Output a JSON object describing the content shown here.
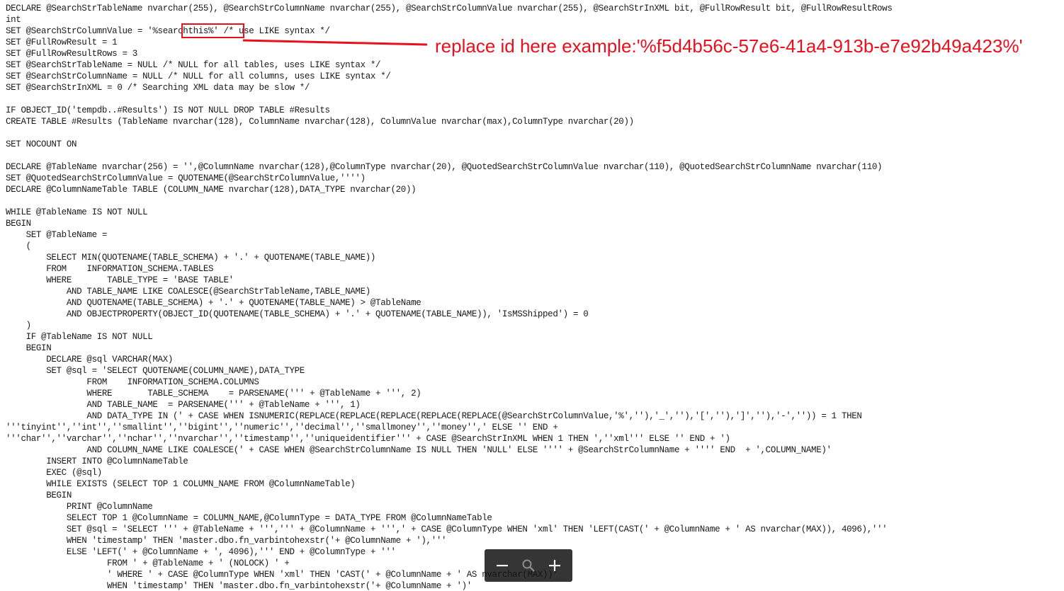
{
  "code": {
    "lines": [
      "DECLARE @SearchStrTableName nvarchar(255), @SearchStrColumnName nvarchar(255), @SearchStrColumnValue nvarchar(255), @SearchStrInXML bit, @FullRowResult bit, @FullRowResultRows",
      "int",
      "SET @SearchStrColumnValue = '%searchthis%' /* use LIKE syntax */",
      "SET @FullRowResult = 1",
      "SET @FullRowResultRows = 3",
      "SET @SearchStrTableName = NULL /* NULL for all tables, uses LIKE syntax */",
      "SET @SearchStrColumnName = NULL /* NULL for all columns, uses LIKE syntax */",
      "SET @SearchStrInXML = 0 /* Searching XML data may be slow */",
      "",
      "IF OBJECT_ID('tempdb..#Results') IS NOT NULL DROP TABLE #Results",
      "CREATE TABLE #Results (TableName nvarchar(128), ColumnName nvarchar(128), ColumnValue nvarchar(max),ColumnType nvarchar(20))",
      "",
      "SET NOCOUNT ON",
      "",
      "DECLARE @TableName nvarchar(256) = '',@ColumnName nvarchar(128),@ColumnType nvarchar(20), @QuotedSearchStrColumnValue nvarchar(110), @QuotedSearchStrColumnName nvarchar(110)",
      "SET @QuotedSearchStrColumnValue = QUOTENAME(@SearchStrColumnValue,'''')",
      "DECLARE @ColumnNameTable TABLE (COLUMN_NAME nvarchar(128),DATA_TYPE nvarchar(20))",
      "",
      "WHILE @TableName IS NOT NULL",
      "BEGIN",
      "    SET @TableName =",
      "    (",
      "        SELECT MIN(QUOTENAME(TABLE_SCHEMA) + '.' + QUOTENAME(TABLE_NAME))",
      "        FROM    INFORMATION_SCHEMA.TABLES",
      "        WHERE       TABLE_TYPE = 'BASE TABLE'",
      "            AND TABLE_NAME LIKE COALESCE(@SearchStrTableName,TABLE_NAME)",
      "            AND QUOTENAME(TABLE_SCHEMA) + '.' + QUOTENAME(TABLE_NAME) > @TableName",
      "            AND OBJECTPROPERTY(OBJECT_ID(QUOTENAME(TABLE_SCHEMA) + '.' + QUOTENAME(TABLE_NAME)), 'IsMSShipped') = 0",
      "    )",
      "    IF @TableName IS NOT NULL",
      "    BEGIN",
      "        DECLARE @sql VARCHAR(MAX)",
      "        SET @sql = 'SELECT QUOTENAME(COLUMN_NAME),DATA_TYPE",
      "                FROM    INFORMATION_SCHEMA.COLUMNS",
      "                WHERE       TABLE_SCHEMA    = PARSENAME(''' + @TableName + ''', 2)",
      "                AND TABLE_NAME  = PARSENAME(''' + @TableName + ''', 1)",
      "                AND DATA_TYPE IN (' + CASE WHEN ISNUMERIC(REPLACE(REPLACE(REPLACE(REPLACE(REPLACE(@SearchStrColumnValue,'%',''),'_',''),'[',''),']',''),'-','')) = 1 THEN",
      "'''tinyint'',''int'',''smallint'',''bigint'',''numeric'',''decimal'',''smallmoney'',''money'',' ELSE '' END +",
      "'''char'',''varchar'',''nchar'',''nvarchar'',''timestamp'',''uniqueidentifier''' + CASE @SearchStrInXML WHEN 1 THEN ',''xml''' ELSE '' END + ')",
      "                AND COLUMN_NAME LIKE COALESCE(' + CASE WHEN @SearchStrColumnName IS NULL THEN 'NULL' ELSE '''' + @SearchStrColumnName + '''' END  + ',COLUMN_NAME)'",
      "        INSERT INTO @ColumnNameTable",
      "        EXEC (@sql)",
      "        WHILE EXISTS (SELECT TOP 1 COLUMN_NAME FROM @ColumnNameTable)",
      "        BEGIN",
      "            PRINT @ColumnName",
      "            SELECT TOP 1 @ColumnName = COLUMN_NAME,@ColumnType = DATA_TYPE FROM @ColumnNameTable",
      "            SET @sql = 'SELECT ''' + @TableName + ''',''' + @ColumnName + ''',' + CASE @ColumnType WHEN 'xml' THEN 'LEFT(CAST(' + @ColumnName + ' AS nvarchar(MAX)), 4096),'''",
      "            WHEN 'timestamp' THEN 'master.dbo.fn_varbintohexstr('+ @ColumnName + '),'''",
      "            ELSE 'LEFT(' + @ColumnName + ', 4096),''' END + @ColumnType + '''",
      "                    FROM ' + @TableName + ' (NOLOCK) ' +",
      "                    ' WHERE ' + CASE @ColumnType WHEN 'xml' THEN 'CAST(' + @ColumnName + ' AS nvarchar(MAX))'",
      "                    WHEN 'timestamp' THEN 'master.dbo.fn_varbintohexstr('+ @ColumnName + ')'"
    ]
  },
  "annotation": {
    "text": "replace id here example:'%f5d4b56c-57e6-41a4-913b-e7e92b49a423%'",
    "color": "#e8101c"
  },
  "toolbar": {
    "zoom_out_icon": "minus-icon",
    "zoom_reset_icon": "magnifier-icon",
    "zoom_in_icon": "plus-icon"
  }
}
